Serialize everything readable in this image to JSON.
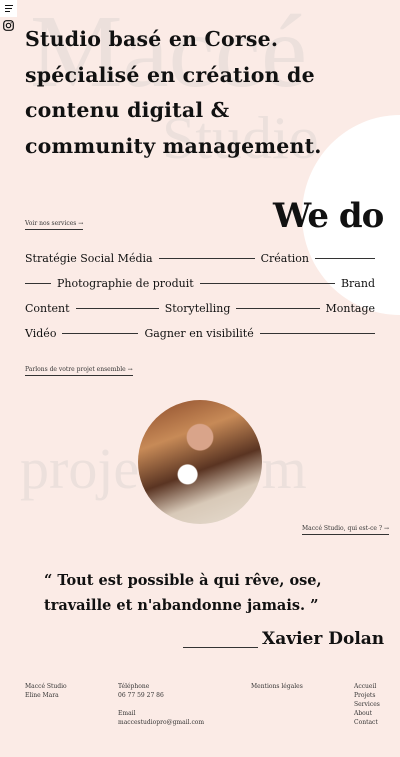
{
  "watermarks": {
    "top": "Maccé",
    "top2": "Studio",
    "middle": "projets de m"
  },
  "nav": {
    "menu_icon": "hamburger-icon",
    "instagram_icon": "instagram-icon"
  },
  "hero": {
    "lines": [
      "Studio basé en Corse.",
      "spécialisé en création de",
      "contenu digital &",
      "community management."
    ]
  },
  "services": {
    "link": "Voir nos services →",
    "title": "We do",
    "rows": [
      [
        "Stratégie Social Média",
        "Création"
      ],
      [
        "Photographie de produit",
        "Brand"
      ],
      [
        "Content",
        "Storytelling",
        "Montage"
      ],
      [
        "Vidéo",
        "Gagner en visibilité"
      ]
    ]
  },
  "contact_link": "Parlons de votre projet ensemble →",
  "about_link": "Maccé Studio, qui est-ce ? →",
  "quote": {
    "line1": "“ Tout est possible à qui rêve, ose,",
    "line2": "travaille et n'abandonne jamais. ”",
    "author": "Xavier Dolan"
  },
  "footer": {
    "studio": "Maccé Studio",
    "name": "Eline Mara",
    "phone_label": "Téléphone",
    "phone": "06 77 59 27 86",
    "email_label": "Email",
    "email": "maccestudiopro@gmail.com",
    "legal": "Mentions légales",
    "links": [
      "Accueil",
      "Projets",
      "Services",
      "About",
      "Contact"
    ]
  }
}
